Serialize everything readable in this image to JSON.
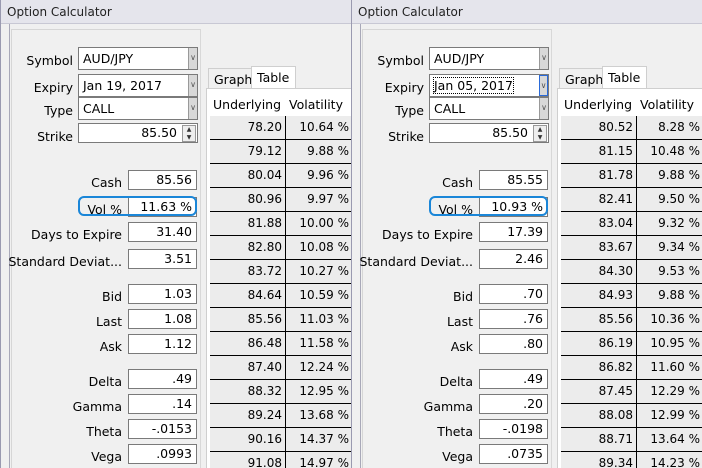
{
  "accent": "#1a86d8",
  "windows": [
    {
      "title": "Option Calculator",
      "symbol": {
        "label": "Symbol",
        "value": "AUD/JPY"
      },
      "expiry": {
        "label": "Expiry",
        "value": "Jan 19, 2017",
        "focused": false
      },
      "type": {
        "label": "Type",
        "value": "CALL"
      },
      "strike": {
        "label": "Strike",
        "value": "85.50"
      },
      "fields": [
        {
          "label": "Cash",
          "value": "85.56"
        },
        {
          "label": "Vol %",
          "value": "11.63 %"
        },
        {
          "label": "Days to Expire",
          "value": "31.40"
        },
        {
          "label": "Standard Deviat...",
          "value": "3.51"
        },
        {
          "label": "Bid",
          "value": "1.03"
        },
        {
          "label": "Last",
          "value": "1.08"
        },
        {
          "label": "Ask",
          "value": "1.12"
        },
        {
          "label": "Delta",
          "value": ".49"
        },
        {
          "label": "Gamma",
          "value": ".14"
        },
        {
          "label": "Theta",
          "value": "-.0153"
        },
        {
          "label": "Vega",
          "value": ".0993"
        }
      ],
      "tabs": [
        "Graph",
        "Table"
      ],
      "table": {
        "headers": [
          "Underlying",
          "Volatility"
        ],
        "rows": [
          [
            "78.20",
            "10.64 %"
          ],
          [
            "79.12",
            "9.88 %"
          ],
          [
            "80.04",
            "9.96 %"
          ],
          [
            "80.96",
            "9.97 %"
          ],
          [
            "81.88",
            "10.00 %"
          ],
          [
            "82.80",
            "10.08 %"
          ],
          [
            "83.72",
            "10.27 %"
          ],
          [
            "84.64",
            "10.59 %"
          ],
          [
            "85.56",
            "11.03 %"
          ],
          [
            "86.48",
            "11.58 %"
          ],
          [
            "87.40",
            "12.24 %"
          ],
          [
            "88.32",
            "12.95 %"
          ],
          [
            "89.24",
            "13.68 %"
          ],
          [
            "90.16",
            "14.37 %"
          ],
          [
            "91.08",
            "14.97 %"
          ]
        ]
      }
    },
    {
      "title": "Option Calculator",
      "symbol": {
        "label": "Symbol",
        "value": "AUD/JPY"
      },
      "expiry": {
        "label": "Expiry",
        "value": "Jan 05, 2017",
        "focused": true
      },
      "type": {
        "label": "Type",
        "value": "CALL"
      },
      "strike": {
        "label": "Strike",
        "value": "85.50"
      },
      "fields": [
        {
          "label": "Cash",
          "value": "85.55"
        },
        {
          "label": "Vol %",
          "value": "10.93 %"
        },
        {
          "label": "Days to Expire",
          "value": "17.39"
        },
        {
          "label": "Standard Deviat...",
          "value": "2.46"
        },
        {
          "label": "Bid",
          "value": ".70"
        },
        {
          "label": "Last",
          "value": ".76"
        },
        {
          "label": "Ask",
          "value": ".80"
        },
        {
          "label": "Delta",
          "value": ".49"
        },
        {
          "label": "Gamma",
          "value": ".20"
        },
        {
          "label": "Theta",
          "value": "-.0198"
        },
        {
          "label": "Vega",
          "value": ".0735"
        }
      ],
      "tabs": [
        "Graph",
        "Table"
      ],
      "table": {
        "headers": [
          "Underlying",
          "Volatility"
        ],
        "rows": [
          [
            "80.52",
            "8.28 %"
          ],
          [
            "81.15",
            "10.48 %"
          ],
          [
            "81.78",
            "9.88 %"
          ],
          [
            "82.41",
            "9.50 %"
          ],
          [
            "83.04",
            "9.32 %"
          ],
          [
            "83.67",
            "9.34 %"
          ],
          [
            "84.30",
            "9.53 %"
          ],
          [
            "84.93",
            "9.88 %"
          ],
          [
            "85.56",
            "10.36 %"
          ],
          [
            "86.19",
            "10.95 %"
          ],
          [
            "86.82",
            "11.60 %"
          ],
          [
            "87.45",
            "12.29 %"
          ],
          [
            "88.08",
            "12.99 %"
          ],
          [
            "88.71",
            "13.64 %"
          ],
          [
            "89.34",
            "14.23 %"
          ]
        ]
      }
    }
  ]
}
